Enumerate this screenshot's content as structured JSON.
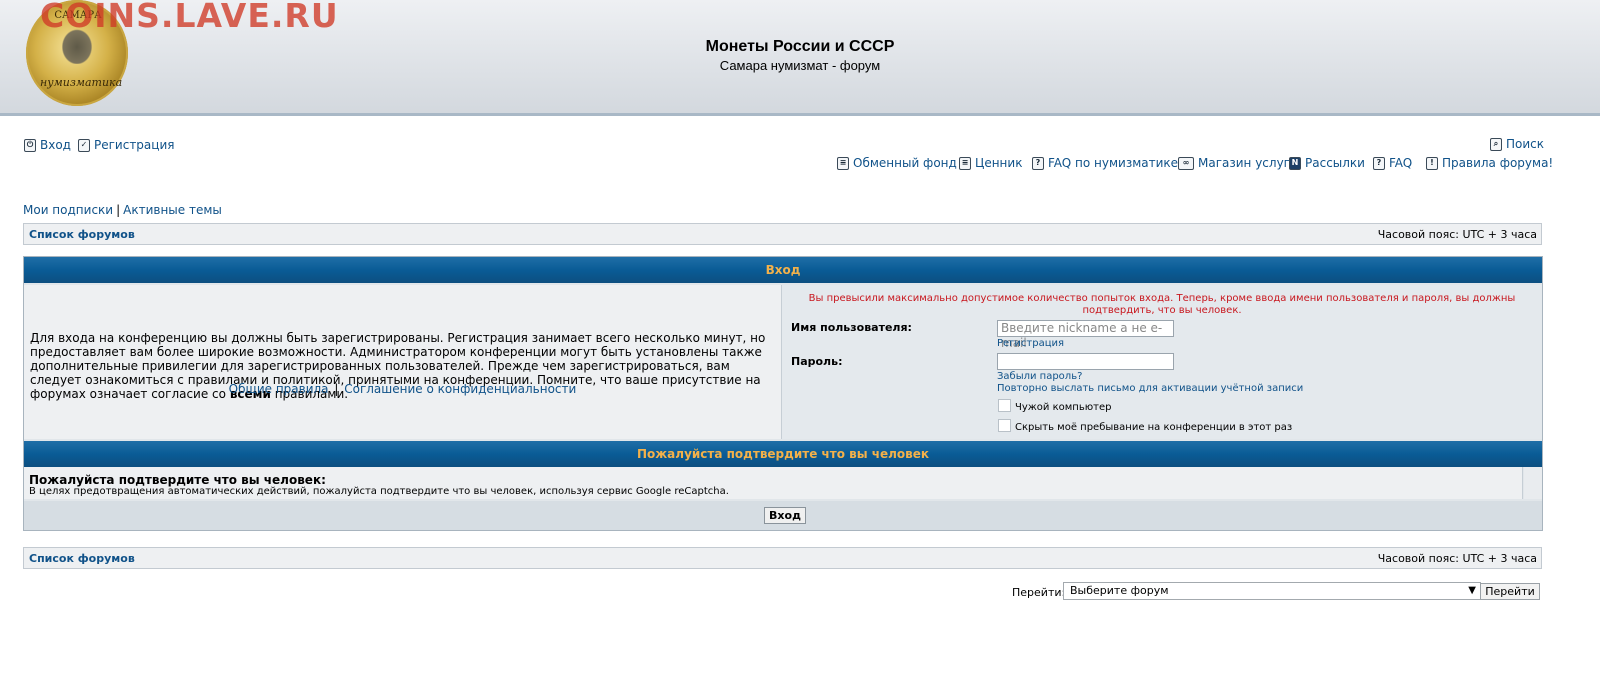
{
  "header": {
    "watermark": "COINS.LAVE.RU",
    "logo_top_text": "САМАРА",
    "logo_bottom_text": "нумизматика",
    "site_title": "Монеты России и СССР",
    "site_description": "Самара нумизмат - форум"
  },
  "nav_top_left": [
    {
      "label": "Вход",
      "icon": "power-icon"
    },
    {
      "label": "Регистрация",
      "icon": "checkbox-icon"
    }
  ],
  "nav_search": {
    "label": "Поиск",
    "icon": "search-icon"
  },
  "nav_links": [
    {
      "label": "Обменный фонд",
      "icon": "list-icon"
    },
    {
      "label": "Ценник",
      "icon": "list-icon"
    },
    {
      "label": "FAQ по нумизматике",
      "icon": "faq-icon"
    },
    {
      "label": "Магазин услуг",
      "icon": "handshake-icon"
    },
    {
      "label": "Рассылки",
      "icon": "newsletter-icon"
    },
    {
      "label": "FAQ",
      "icon": "faq-icon"
    },
    {
      "label": "Правила форума!",
      "icon": "exclamation-icon"
    }
  ],
  "subscriptions": {
    "my_subs": "Мои подписки",
    "separator": "|",
    "active": "Активные темы"
  },
  "breadcrumb": {
    "forum_list": "Список форумов",
    "timezone": "Часовой пояс: UTC + 3 часа"
  },
  "login": {
    "header": "Вход",
    "intro_part1": "Для входа на конференцию вы должны быть зарегистрированы. Регистрация занимает всего несколько минут, но предоставляет вам более широкие возможности. Администратором конференции могут быть установлены также дополнительные привилегии для зарегистрированных пользователей. Прежде чем зарегистрироваться, вам следует ознакомиться с правилами и политикой, принятыми на конференции. Помните, что ваше присутствие на форумах означает согласие со ",
    "intro_bold": "всеми",
    "intro_part2": " правилами.",
    "rules_link": "Общие правила",
    "links_sep": "|",
    "privacy_link": "Соглашение о конфиденциальности",
    "warning": "Вы превысили максимально допустимое количество попыток входа. Теперь, кроме ввода имени пользователя и пароля, вы должны подтвердить, что вы человек.",
    "username_label": "Имя пользователя:",
    "username_placeholder": "Введите nickname а не e-mail",
    "register_link": "Регистрация",
    "password_label": "Пароль:",
    "forgot_link": "Забыли пароль?",
    "resend_link": "Повторно выслать письмо для активации учётной записи",
    "public_computer": "Чужой компьютер",
    "hide_online": "Скрыть моё пребывание на конференции в этот раз"
  },
  "captcha": {
    "header": "Пожалуйста подтвердите что вы человек",
    "title": "Пожалуйста подтвердите что вы человек:",
    "description": "В целях предотвращения автоматических действий, пожалуйста подтвердите что вы человек, используя сервис Google reCaptcha."
  },
  "submit_label": "Вход",
  "jumpbox": {
    "label": "Перейти:",
    "selected": "Выберите форум",
    "button": "Перейти"
  },
  "colors": {
    "link": "#105289",
    "header_accent": "#f3b14a",
    "warning": "#c8171e",
    "cat_bar": "#0a5c96"
  }
}
